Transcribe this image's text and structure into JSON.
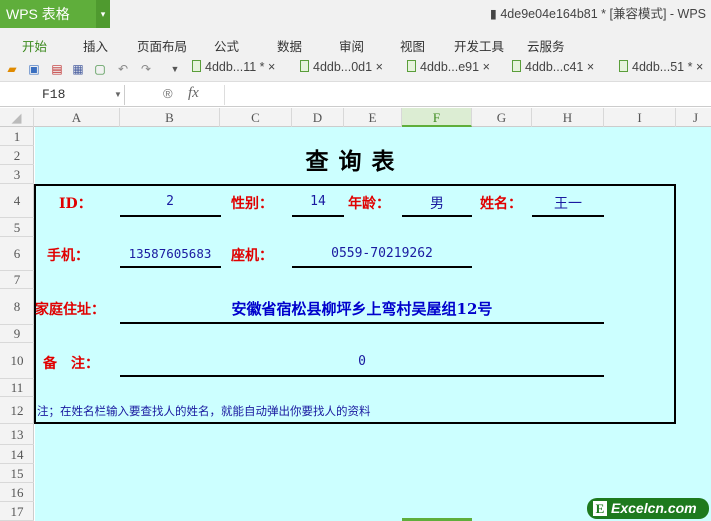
{
  "app": {
    "name": "WPS 表格",
    "doc_title": "4de9e04e164b81 * [兼容模式] - WPS"
  },
  "menu": [
    "开始",
    "插入",
    "页面布局",
    "公式",
    "数据",
    "审阅",
    "视图",
    "开发工具",
    "云服务"
  ],
  "tabs": [
    "4ddb...11 *",
    "4ddb...0d1",
    "4ddb...e91",
    "4ddb...c41",
    "4ddb...51 *"
  ],
  "formula": {
    "name_box": "F18",
    "fx": "fx",
    "value": ""
  },
  "columns": [
    "A",
    "B",
    "C",
    "D",
    "E",
    "F",
    "G",
    "H",
    "I",
    "J"
  ],
  "selected_column": "F",
  "rows": [
    "1",
    "2",
    "3",
    "4",
    "5",
    "6",
    "7",
    "8",
    "9",
    "10",
    "11",
    "12",
    "13",
    "14",
    "15",
    "16",
    "17"
  ],
  "sheet": {
    "title": "查询表",
    "id_label": "ID：",
    "id_value": "2",
    "gender_label": "性别：",
    "gender_value": "14",
    "age_label": "年龄：",
    "age_value": "男",
    "name_label": "姓名：",
    "name_value": "王一",
    "mobile_label": "手机：",
    "mobile_value": "13587605683",
    "phone_label": "座机：",
    "phone_value": "0559-70219262",
    "address_label": "家庭住址：",
    "address_value": "安徽省宿松县柳坪乡上弯村吴屋组12号",
    "remark_label": "备　注：",
    "remark_value": "0",
    "note": "注；在姓名栏输入要查找人的姓名，就能自动弹出你要找人的资料"
  },
  "watermark": "Excelcn.com"
}
